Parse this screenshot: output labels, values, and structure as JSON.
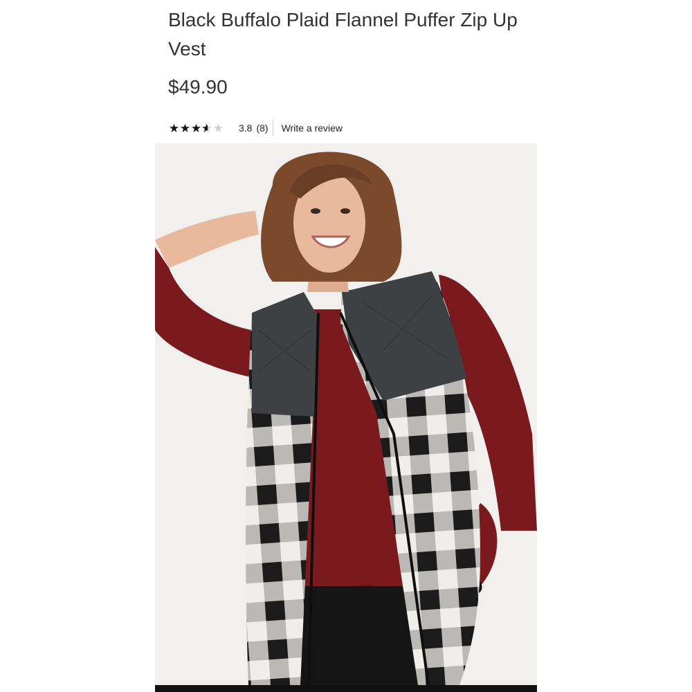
{
  "product": {
    "title": "Black Buffalo Plaid Flannel Puffer Zip Up Vest",
    "price": "$49.90",
    "rating": {
      "value": "3.8",
      "count": "(8)",
      "stars_filled": 3.6,
      "stars_total": 5
    },
    "write_review_label": "Write a review",
    "image": {
      "subject": "product-photo",
      "colors": {
        "background": "#f1f0ee",
        "shirt": "#7a1a1e",
        "vest_yoke": "#3f4044",
        "plaid_dark": "#1b1b1b",
        "plaid_light": "#efeeea",
        "hair": "#7b4a2c",
        "skin": "#e8b99d"
      }
    }
  }
}
